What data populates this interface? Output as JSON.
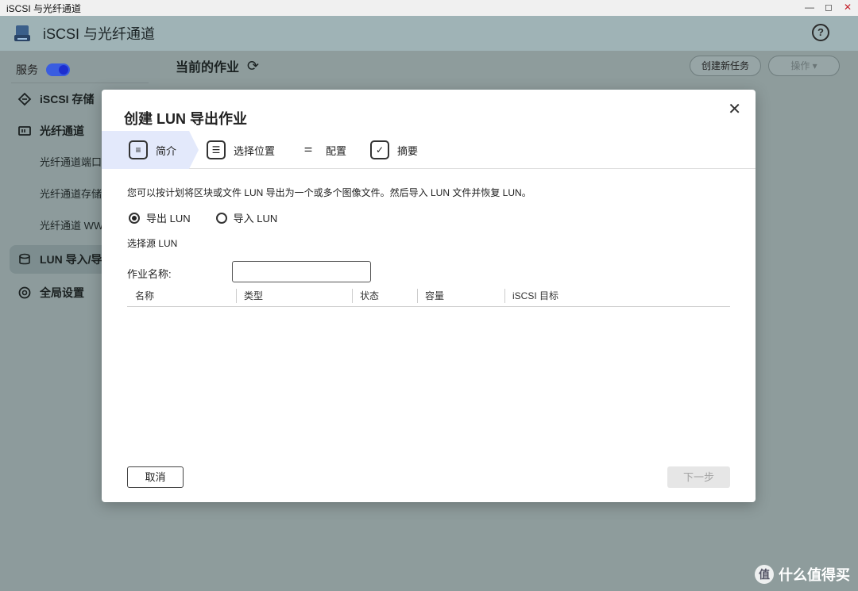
{
  "window": {
    "title": "iSCSI 与光纤通道"
  },
  "app": {
    "title": "iSCSI 与光纤通道",
    "help_icon": "help-circle-icon"
  },
  "sidebar": {
    "service_label": "服务",
    "service_on": true,
    "items": [
      {
        "label": "iSCSI 存储",
        "icon": "iscsi-storage-icon"
      },
      {
        "label": "光纤通道",
        "icon": "fibre-channel-icon"
      },
      {
        "label": "光纤通道端口",
        "sub": true
      },
      {
        "label": "光纤通道存储",
        "sub": true
      },
      {
        "label": "光纤通道 WWN",
        "sub": true
      },
      {
        "label": "LUN 导入/导出",
        "icon": "lun-import-export-icon",
        "active": true
      },
      {
        "label": "全局设置",
        "icon": "gear-icon"
      }
    ]
  },
  "main": {
    "title": "当前的作业",
    "new_task": "创建新任务",
    "actions": "操作 ▾"
  },
  "dialog": {
    "title": "创建 LUN 导出作业",
    "steps": [
      {
        "label": "简介",
        "active": true
      },
      {
        "label": "选择位置"
      },
      {
        "label": "配置"
      },
      {
        "label": "摘要"
      }
    ],
    "description": "您可以按计划将区块或文件 LUN 导出为一个或多个图像文件。然后导入 LUN 文件并恢复 LUN。",
    "radio_export": "导出 LUN",
    "radio_import": "导入 LUN",
    "source_label": "选择源 LUN",
    "job_name_label": "作业名称:",
    "job_name_value": "",
    "table_headers": [
      "名称",
      "类型",
      "状态",
      "容量",
      "iSCSI 目标"
    ],
    "cancel": "取消",
    "next": "下一步"
  },
  "watermark": {
    "text": "什么值得买",
    "logo": "值"
  }
}
